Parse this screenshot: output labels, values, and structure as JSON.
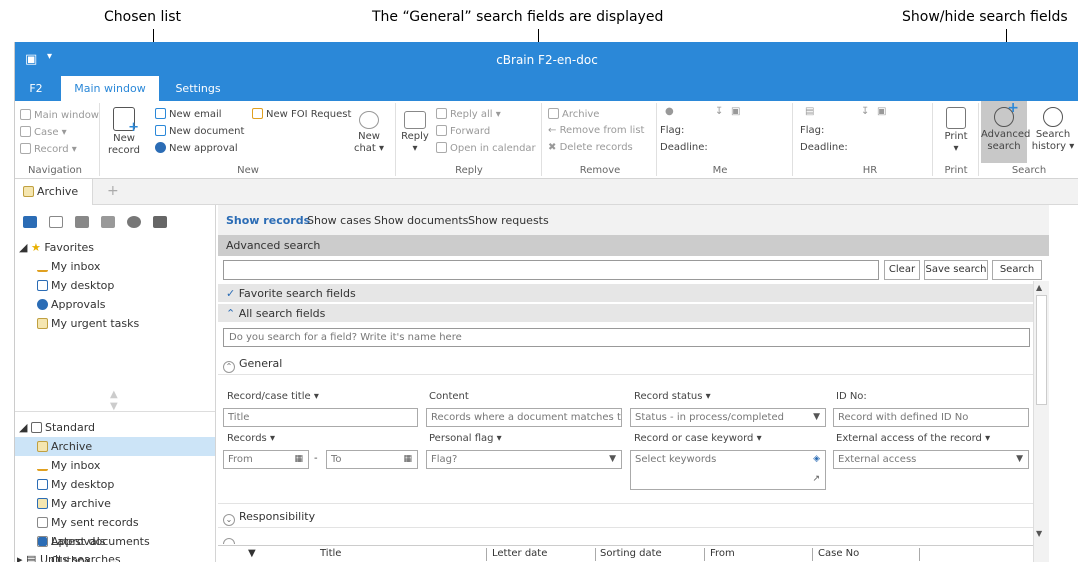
{
  "annotations": {
    "chosen_list": "Chosen list",
    "general_fields": "The “General” search fields are displayed",
    "show_hide": "Show/hide search fields"
  },
  "window": {
    "title": "cBrain F2-en-doc"
  },
  "ribbon_tabs": [
    "F2",
    "Main window",
    "Settings"
  ],
  "ribbon": {
    "navigation": {
      "main_window": "Main window",
      "case": "Case",
      "record": "Record",
      "label": "Navigation"
    },
    "new": {
      "new_record": "New record",
      "new_email": "New email",
      "new_document": "New document",
      "new_approval": "New approval",
      "new_foi_request": "New FOI Request",
      "new_chat": "New chat",
      "label": "New"
    },
    "reply": {
      "reply": "Reply",
      "reply_all": "Reply all",
      "forward": "Forward",
      "open_in_calendar": "Open in calendar",
      "label": "Reply"
    },
    "remove": {
      "archive": "Archive",
      "remove_from_list": "Remove from list",
      "delete_records": "Delete records",
      "label": "Remove"
    },
    "me": {
      "flag": "Flag:",
      "deadline": "Deadline:",
      "label": "Me"
    },
    "hr": {
      "flag": "Flag:",
      "deadline": "Deadline:",
      "label": "HR"
    },
    "print": {
      "print": "Print",
      "label": "Print"
    },
    "search": {
      "advanced_search": "Advanced search",
      "search_history": "Search history",
      "label": "Search"
    }
  },
  "doc_tab": "Archive",
  "sidebar": {
    "favorites_header": "Favorites",
    "favorites": [
      "My inbox",
      "My desktop",
      "Approvals",
      "My urgent tasks"
    ],
    "standard_header": "Standard",
    "standard": [
      "Archive",
      "My inbox",
      "My desktop",
      "My archive",
      "My sent records",
      "Approvals",
      "Outbox",
      "Latest documents"
    ],
    "units_searches": "Units searches"
  },
  "show_tabs": [
    "Show records",
    "Show cases",
    "Show documents",
    "Show requests"
  ],
  "advanced_search_header": "Advanced search",
  "buttons": {
    "clear": "Clear",
    "save_search": "Save search",
    "search": "Search"
  },
  "accordions": {
    "favorite_fields": "Favorite search fields",
    "all_fields": "All search fields"
  },
  "field_search_placeholder": "Do you search for a field? Write it's name here",
  "general_section": "General",
  "fields": {
    "record_case_title": {
      "label": "Record/case title",
      "placeholder": "Title"
    },
    "content": {
      "label": "Content",
      "placeholder": "Records where a document matches th..."
    },
    "record_status": {
      "label": "Record status",
      "value": "Status - in process/completed"
    },
    "id_no": {
      "label": "ID No:",
      "placeholder": "Record with defined ID No"
    },
    "records": {
      "label": "Records",
      "from": "From",
      "to": "To",
      "dash": "-"
    },
    "personal_flag": {
      "label": "Personal flag",
      "placeholder": "Flag?"
    },
    "keyword": {
      "label": "Record or case keyword",
      "placeholder": "Select keywords"
    },
    "external_access": {
      "label": "External access of the record",
      "value": "External access"
    }
  },
  "responsibility_section": "Responsibility",
  "grid_columns": [
    "Title",
    "Letter date",
    "Sorting date",
    "From",
    "Case No"
  ]
}
